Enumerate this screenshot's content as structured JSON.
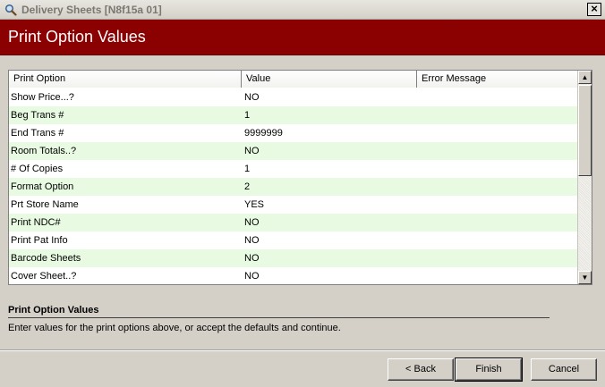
{
  "window": {
    "title": "Delivery Sheets [N8f15a 01]",
    "icon": "search-icon",
    "close_glyph": "×"
  },
  "banner": {
    "title": "Print Option Values"
  },
  "grid": {
    "columns": [
      "Print Option",
      "Value",
      "Error Message"
    ],
    "rows": [
      {
        "option": "Show Price...?",
        "value": "NO",
        "error": ""
      },
      {
        "option": "Beg Trans #",
        "value": "1",
        "error": ""
      },
      {
        "option": "End Trans #",
        "value": "9999999",
        "error": ""
      },
      {
        "option": "Room Totals..?",
        "value": "NO",
        "error": ""
      },
      {
        "option": "# Of Copies",
        "value": "1",
        "error": ""
      },
      {
        "option": "Format Option",
        "value": "2",
        "error": ""
      },
      {
        "option": "Prt Store Name",
        "value": "YES",
        "error": ""
      },
      {
        "option": "Print NDC#",
        "value": "NO",
        "error": ""
      },
      {
        "option": "Print Pat Info",
        "value": "NO",
        "error": ""
      },
      {
        "option": "Barcode Sheets",
        "value": "NO",
        "error": ""
      },
      {
        "option": "Cover Sheet..?",
        "value": "NO",
        "error": ""
      }
    ],
    "alt_row_color": "#e8fbe2"
  },
  "description": {
    "title": "Print Option Values",
    "text": "Enter values for the print options above, or accept the defaults and continue."
  },
  "buttons": {
    "back": "< Back",
    "finish": "Finish",
    "cancel": "Cancel"
  },
  "colors": {
    "banner": "#8b0000",
    "background": "#d4d0c8"
  }
}
